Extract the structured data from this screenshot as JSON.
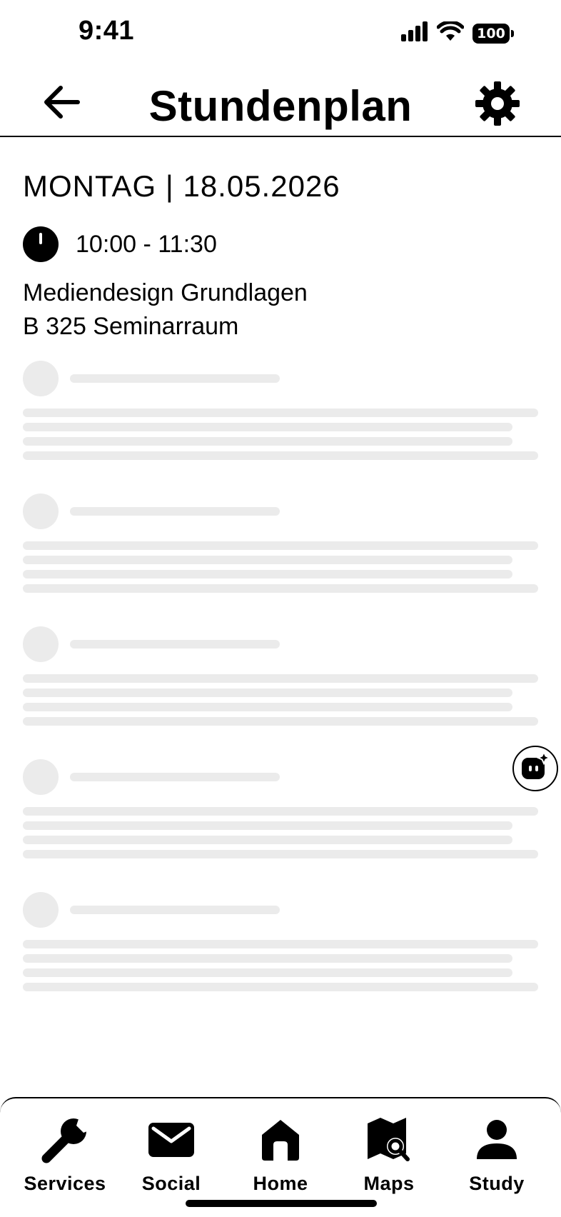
{
  "status_bar": {
    "time": "9:41",
    "battery": "100",
    "icons": [
      "signal-icon",
      "wifi-icon",
      "battery-icon"
    ]
  },
  "header": {
    "title": "Stundenplan",
    "back_icon": "arrow-left-icon",
    "settings_icon": "gear-icon"
  },
  "schedule": {
    "day_heading": "MONTAG | 18.05.2026",
    "time": "10:00 - 11:30",
    "course": "Mediendesign Grundlagen",
    "room": "B 325 Seminarraum"
  },
  "assistant": {
    "icon": "ai-assistant-icon"
  },
  "bottom_nav": {
    "items": [
      {
        "label": "Services",
        "icon": "wrench-icon"
      },
      {
        "label": "Social",
        "icon": "mail-icon"
      },
      {
        "label": "Home",
        "icon": "home-icon"
      },
      {
        "label": "Maps",
        "icon": "map-search-icon"
      },
      {
        "label": "Study",
        "icon": "person-icon"
      }
    ]
  },
  "colors": {
    "text": "#000000",
    "background": "#ffffff",
    "skeleton": "#ebebeb"
  }
}
